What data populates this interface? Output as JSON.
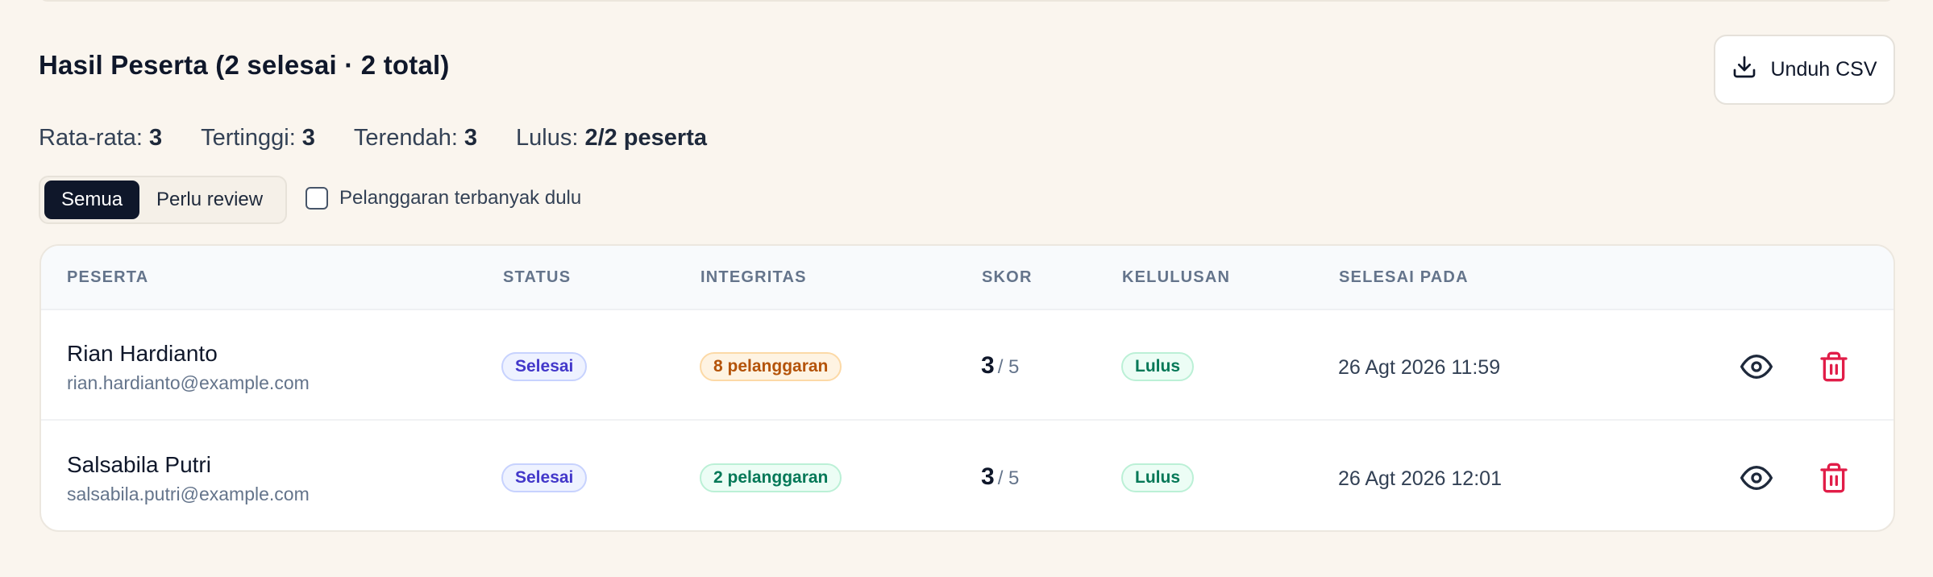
{
  "header": {
    "title": "Hasil Peserta (2 selesai · 2 total)",
    "download_label": "Unduh CSV"
  },
  "stats": [
    {
      "label": "Rata-rata:",
      "value": "3"
    },
    {
      "label": "Tertinggi:",
      "value": "3"
    },
    {
      "label": "Terendah:",
      "value": "3"
    },
    {
      "label": "Lulus:",
      "value": "2/2 peserta"
    }
  ],
  "filters": {
    "segments": [
      "Semua",
      "Perlu review"
    ],
    "active_segment": "Semua",
    "checkbox_label": "Pelanggaran terbanyak dulu",
    "checkbox_checked": false
  },
  "table": {
    "columns": [
      "PESERTA",
      "STATUS",
      "INTEGRITAS",
      "SKOR",
      "KELULUSAN",
      "SELESAI PADA"
    ],
    "rows": [
      {
        "name": "Rian Hardianto",
        "email": "rian.hardianto@example.com",
        "status": "Selesai",
        "integrity": "8 pelanggaran",
        "integrity_level": "warning",
        "score": "3",
        "score_max": "/ 5",
        "result": "Lulus",
        "finished_at": "26 Agt 2026 11:59"
      },
      {
        "name": "Salsabila Putri",
        "email": "salsabila.putri@example.com",
        "status": "Selesai",
        "integrity": "2 pelanggaran",
        "integrity_level": "ok",
        "score": "3",
        "score_max": "/ 5",
        "result": "Lulus",
        "finished_at": "26 Agt 2026 12:01"
      }
    ]
  },
  "icons": {
    "download": "download-icon",
    "view": "eye-icon",
    "delete": "trash-icon"
  },
  "colors": {
    "page_bg": "#faf5ee",
    "primary_dark": "#0f172a",
    "danger": "#e11d48",
    "status_indigo": "#4338ca",
    "warning_amber": "#b45309",
    "success_green": "#047857"
  }
}
